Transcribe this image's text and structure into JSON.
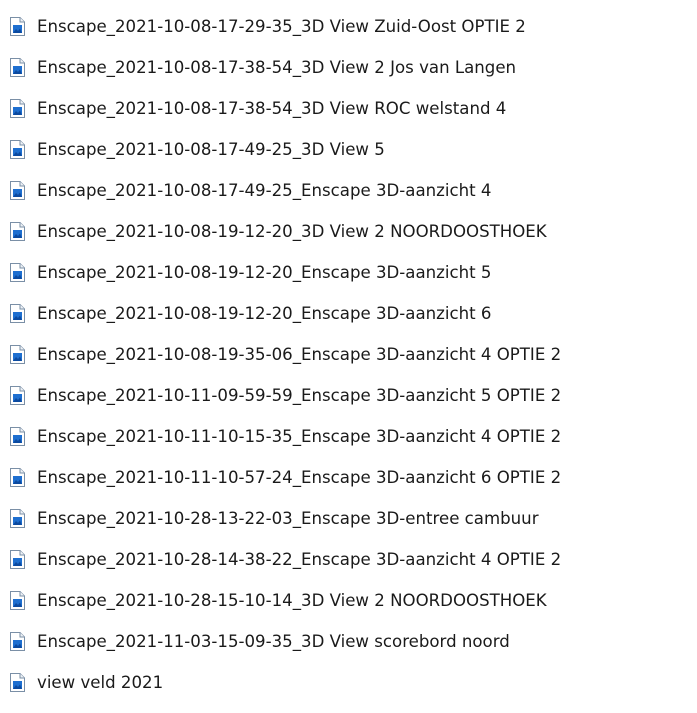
{
  "files": [
    {
      "name": "Enscape_2021-10-08-17-29-35_3D View Zuid-Oost OPTIE 2",
      "icon": "image-file-icon"
    },
    {
      "name": "Enscape_2021-10-08-17-38-54_3D View 2 Jos van Langen",
      "icon": "image-file-icon"
    },
    {
      "name": "Enscape_2021-10-08-17-38-54_3D View ROC welstand 4",
      "icon": "image-file-icon"
    },
    {
      "name": "Enscape_2021-10-08-17-49-25_3D View 5",
      "icon": "image-file-icon"
    },
    {
      "name": "Enscape_2021-10-08-17-49-25_Enscape 3D-aanzicht 4",
      "icon": "image-file-icon"
    },
    {
      "name": "Enscape_2021-10-08-19-12-20_3D View 2 NOORDOOSTHOEK",
      "icon": "image-file-icon"
    },
    {
      "name": "Enscape_2021-10-08-19-12-20_Enscape 3D-aanzicht 5",
      "icon": "image-file-icon"
    },
    {
      "name": "Enscape_2021-10-08-19-12-20_Enscape 3D-aanzicht 6",
      "icon": "image-file-icon"
    },
    {
      "name": "Enscape_2021-10-08-19-35-06_Enscape 3D-aanzicht 4 OPTIE 2",
      "icon": "image-file-icon"
    },
    {
      "name": "Enscape_2021-10-11-09-59-59_Enscape 3D-aanzicht 5 OPTIE 2",
      "icon": "image-file-icon"
    },
    {
      "name": "Enscape_2021-10-11-10-15-35_Enscape 3D-aanzicht 4 OPTIE 2",
      "icon": "image-file-icon"
    },
    {
      "name": "Enscape_2021-10-11-10-57-24_Enscape 3D-aanzicht 6 OPTIE 2",
      "icon": "image-file-icon"
    },
    {
      "name": "Enscape_2021-10-28-13-22-03_Enscape 3D-entree cambuur",
      "icon": "image-file-icon"
    },
    {
      "name": "Enscape_2021-10-28-14-38-22_Enscape 3D-aanzicht 4 OPTIE 2",
      "icon": "image-file-icon"
    },
    {
      "name": "Enscape_2021-10-28-15-10-14_3D View 2 NOORDOOSTHOEK",
      "icon": "image-file-icon"
    },
    {
      "name": "Enscape_2021-11-03-15-09-35_3D View scorebord noord",
      "icon": "image-file-icon"
    },
    {
      "name": "view veld 2021",
      "icon": "image-file-icon"
    }
  ],
  "colors": {
    "text": "#1a1a1a",
    "icon_border": "#7a8fa6",
    "icon_fill": "#ffffff",
    "icon_picture": "#1e6fd0",
    "background": "#ffffff"
  }
}
